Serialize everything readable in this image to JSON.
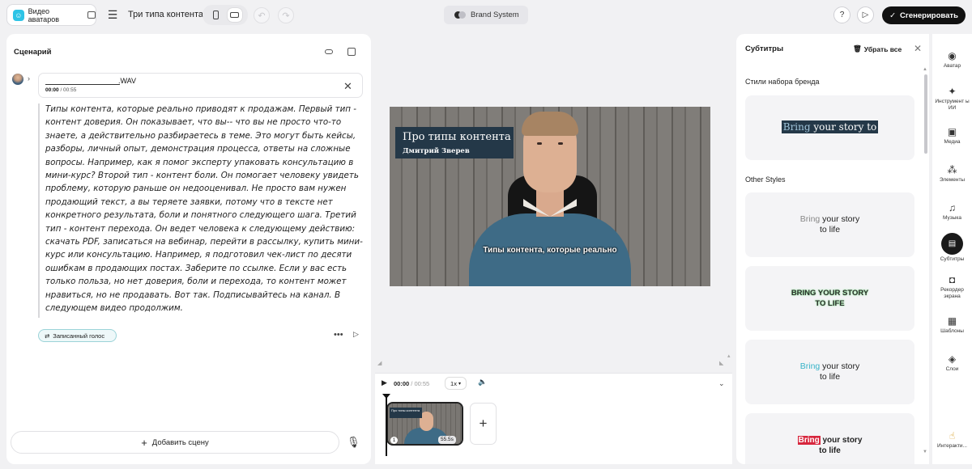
{
  "header": {
    "app_name": "Видео аватаров",
    "project_title": "Три типа контента",
    "brand_label": "Brand System",
    "generate_label": "Сгенерировать"
  },
  "script_panel": {
    "title": "Сценарий",
    "audio": {
      "file_name": ".WAV",
      "time_current": "00:00",
      "time_total": "/ 00:55"
    },
    "text": "Типы контента, которые реально приводят к продажам. Первый тип - контент доверия. Он показывает, что вы-- что вы не просто что-то знаете, а действительно разбираетесь в теме. Это могут быть кейсы, разборы, личный опыт, демонстрация процесса, ответы на сложные вопросы. Например, как я помог эксперту упаковать консультацию в мини-курс? Второй тип - контент боли. Он помогает человеку увидеть проблему, которую раньше он недооценивал. Не просто вам нужен продающий текст, а вы теряете заявки, потому что в тексте нет конкретного результата, боли и понятного следующего шага. Третий тип - контент перехода. Он ведет человека к следующему действию: скачать PDF, записаться на вебинар, перейти в рассылку, купить мини-курс или консультацию. Например, я подготовил чек-лист по десяти ошибкам в продающих постах. Заберите по ссылке. Если у вас есть только польза, но нет доверия, боли и перехода, то контент может нравиться, но не продавать. Вот так. Подписывайтесь на канал. В следующем видео продолжим.",
    "voice_chip": "Записанный голос",
    "add_scene": "Добавить сцену"
  },
  "preview": {
    "title_main": "Про типы контента",
    "title_sub": "Дмитрий Зверев",
    "subtitle": "Типы контента, которые реально"
  },
  "timeline": {
    "time_current": "00:00",
    "time_total": "/ 00:55",
    "speed": "1x",
    "scene_number": "1",
    "scene_duration": "55.5s",
    "thumb_title": "Про типы контента"
  },
  "subtitles_panel": {
    "title": "Субтитры",
    "remove_all": "Убрать все",
    "brand_styles_label": "Стили набора бренда",
    "other_styles_label": "Other Styles",
    "styles": [
      {
        "word1": "Bring",
        "rest": " your story to"
      },
      {
        "line1a": "Bring",
        "line1b": " your story",
        "line2": "to life"
      },
      {
        "line1": "BRING YOUR STORY",
        "line2": "TO LIFE"
      },
      {
        "line1a": "Bring",
        "line1b": " your story",
        "line2": "to life"
      },
      {
        "line1a": "Bring",
        "line1b": " your story",
        "line2": "to life"
      }
    ]
  },
  "toolbar": {
    "items": [
      {
        "label": "Аватар",
        "icon": "avatar-icon"
      },
      {
        "label": "Инструмент ы ИИ",
        "icon": "ai-tools-icon"
      },
      {
        "label": "Медиа",
        "icon": "media-icon"
      },
      {
        "label": "Элементы",
        "icon": "elements-icon"
      },
      {
        "label": "Музыка",
        "icon": "music-icon"
      },
      {
        "label": "Субтитры",
        "icon": "subtitles-icon"
      },
      {
        "label": "Рекордер экрана",
        "icon": "screen-recorder-icon"
      },
      {
        "label": "Шаблоны",
        "icon": "templates-icon"
      },
      {
        "label": "Слои",
        "icon": "layers-icon"
      },
      {
        "label": "Интеракти...",
        "icon": "interactive-icon"
      }
    ]
  },
  "colors": {
    "accent_teal": "#2ec4e6",
    "title_card": "#243848",
    "generate_bg": "#111111",
    "subtitle_accent": "#36b3c8",
    "subtitle_highlight": "#d7263d"
  }
}
